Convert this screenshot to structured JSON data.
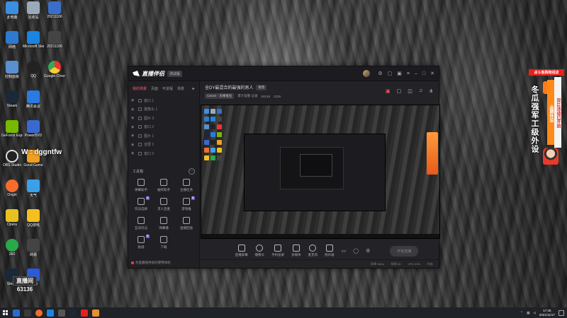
{
  "desktop": {
    "icons": [
      {
        "label": "此电脑"
      },
      {
        "label": "回收站"
      },
      {
        "label": "20211106"
      },
      {
        "label": "网络"
      },
      {
        "label": "Microsoft Store"
      },
      {
        "label": "20211106"
      },
      {
        "label": "控制面板"
      },
      {
        "label": "QQ"
      },
      {
        "label": "Google Chrome"
      },
      {
        "label": "Steam"
      },
      {
        "label": "腾讯会议"
      },
      {
        "label": "GeForce Experience"
      },
      {
        "label": "PowerDVD"
      },
      {
        "label": "OBS Studio"
      },
      {
        "label": "Good Game"
      },
      {
        "label": "Origin"
      },
      {
        "label": "天气"
      },
      {
        "label": "Opera"
      },
      {
        "label": "QQ游戏"
      },
      {
        "label": "360"
      },
      {
        "label": "网易"
      },
      {
        "label": "Steam"
      },
      {
        "label": "Uplay"
      }
    ],
    "overlay_text": "W : dggntfw",
    "viewer_box": "直播间",
    "viewer_count": "63136"
  },
  "app": {
    "name": "直播伴侣",
    "version_badge": "测试版",
    "left_tabs": [
      "我的场景",
      "页面",
      "可进程",
      "场景"
    ],
    "scenes": [
      {
        "label": "窗口 1"
      },
      {
        "label": "摄像头 1"
      },
      {
        "label": "图片 3"
      },
      {
        "label": "窗口 2"
      },
      {
        "label": "图片 1"
      },
      {
        "label": "全屏 1"
      },
      {
        "label": "窗口 2"
      }
    ],
    "tools_title": "工具箱",
    "tools": [
      {
        "label": "弹幕助手",
        "tag": ""
      },
      {
        "label": "抽奖助手",
        "tag": ""
      },
      {
        "label": "主播任务",
        "tag": ""
      },
      {
        "label": "玩法选择",
        "tag": "新"
      },
      {
        "label": "求人连麦",
        "tag": ""
      },
      {
        "label": "游戏推",
        "tag": "新"
      },
      {
        "label": "互动玩法",
        "tag": ""
      },
      {
        "label": "弹幕播",
        "tag": ""
      },
      {
        "label": "直播回放",
        "tag": ""
      },
      {
        "label": "贴纸",
        "tag": "新"
      },
      {
        "label": "下载",
        "tag": ""
      }
    ],
    "footer_note": "为直播提供良好使用体验",
    "room_title": "全DY最混合的最强的男人",
    "room_btn": "修改",
    "category": "CSGO · 天梯排位",
    "meta_items": [
      "累计观看 记录",
      "63136",
      "2226"
    ],
    "controls": [
      {
        "label": "直播屏幕"
      },
      {
        "label": "摄像头"
      },
      {
        "label": "手机投屏"
      },
      {
        "label": "多媒体"
      },
      {
        "label": "麦克风"
      },
      {
        "label": "扬声器"
      }
    ],
    "start_live": "开始直播",
    "status": [
      "码率 0kb/s",
      "帧率 60",
      "CPU 22%",
      "内存"
    ]
  },
  "right_ad": {
    "head": "点斗鱼购物进店",
    "white_text": "冬瓜强军工级外设",
    "orange_text": "品牌外设",
    "red_text": "双11活动已开启",
    "badge": "T"
  },
  "taskbar": {
    "time": "17:45",
    "date": "2021/11/17"
  },
  "colors": {
    "accent": "#ff5a6a",
    "ad_red": "#e8201a",
    "ad_orange": "#ff8a1a"
  }
}
